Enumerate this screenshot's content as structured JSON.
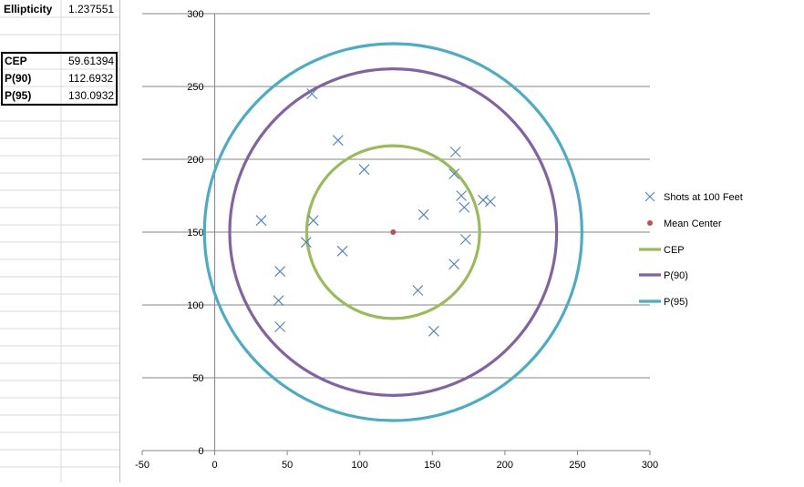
{
  "sheet": {
    "ellipticity_label": "Ellipticity",
    "ellipticity_value": "1.237551",
    "cep_label": "CEP",
    "cep_value": "59.61394",
    "p90_label": "P(90)",
    "p90_value": "112.6932",
    "p95_label": "P(95)",
    "p95_value": "130.0932"
  },
  "colors": {
    "shots": "#4f81bd",
    "mean": "#c0504d",
    "cep": "#9bbb59",
    "p90": "#8064a2",
    "p95": "#4bacc6"
  },
  "chart_data": {
    "type": "scatter",
    "xlim": [
      -50,
      300
    ],
    "ylim": [
      0,
      300
    ],
    "x_ticks": [
      -50,
      0,
      50,
      100,
      150,
      200,
      250,
      300
    ],
    "y_ticks": [
      0,
      50,
      100,
      150,
      200,
      250,
      300
    ],
    "x_tick_labels": [
      "-50",
      "0",
      "50",
      "100",
      "150",
      "200",
      "250",
      "300"
    ],
    "y_tick_labels": [
      "0",
      "50",
      "100",
      "150",
      "200",
      "250",
      "300"
    ],
    "grid": "horizontal",
    "legend_position": "right",
    "series": [
      {
        "name": "Shots at 100 Feet",
        "marker": "x",
        "x": [
          67,
          85,
          103,
          166,
          165,
          170,
          172,
          185,
          190,
          32,
          68,
          63,
          88,
          144,
          173,
          165,
          45,
          44,
          45,
          140,
          151
        ],
        "y": [
          245,
          213,
          193,
          205,
          190,
          175,
          167,
          172,
          171,
          158,
          158,
          143,
          137,
          162,
          145,
          128,
          123,
          103,
          85,
          110,
          82
        ]
      },
      {
        "name": "Mean Center",
        "marker": "dot",
        "x": [
          123
        ],
        "y": [
          150
        ]
      }
    ],
    "circles": [
      {
        "name": "CEP",
        "cx": 123,
        "cy": 150,
        "r": 59.61394
      },
      {
        "name": "P(90)",
        "cx": 123,
        "cy": 150,
        "r": 112.6932
      },
      {
        "name": "P(95)",
        "cx": 123,
        "cy": 150,
        "r": 130.0932
      }
    ],
    "legend": [
      "Shots at 100 Feet",
      "Mean Center",
      "CEP",
      "P(90)",
      "P(95)"
    ]
  }
}
